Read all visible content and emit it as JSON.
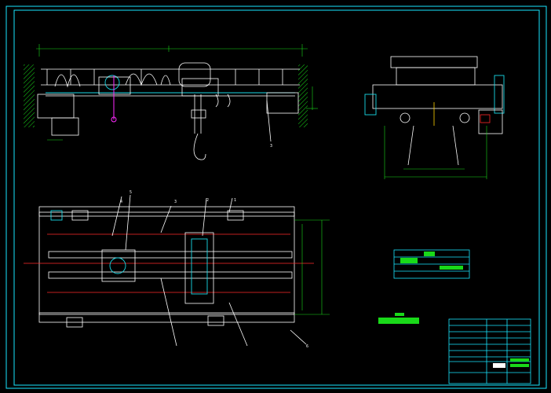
{
  "drawing": {
    "background": "#000000",
    "colors": {
      "frame": "#19e6ff",
      "line": "#ffffff",
      "part": "#19d9e6",
      "dim": "#19d919",
      "accent": "#ff2a2a",
      "magenta": "#ff2aff",
      "yellow": "#ffd200"
    },
    "views": {
      "front_elevation": "crane-front-view",
      "side_elevation": "crane-side-view",
      "plan": "crane-plan-view"
    },
    "balloons": [
      "1",
      "2",
      "3",
      "4",
      "5",
      "6"
    ],
    "tables": {
      "parts_legend": "parts-legend-table",
      "title_block": "title-block"
    }
  }
}
